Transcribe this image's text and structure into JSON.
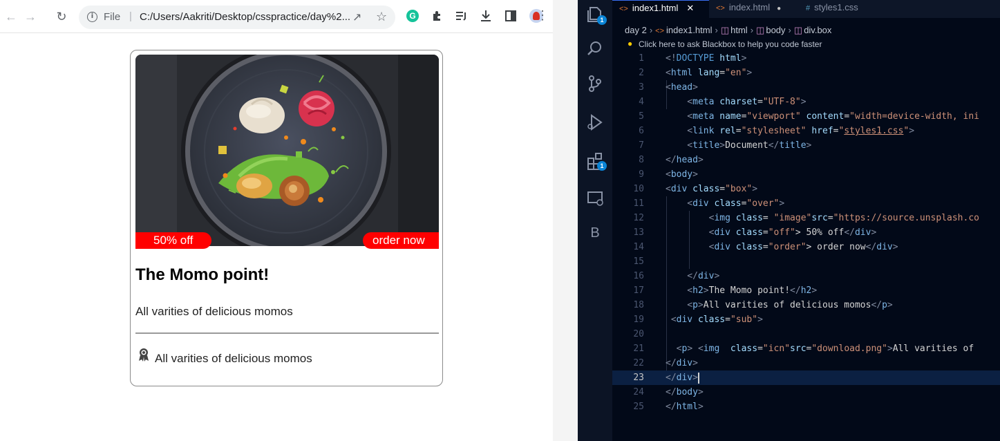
{
  "browser": {
    "url_prefix": "File",
    "url_text": "C:/Users/Aakriti/Desktop/csspractice/day%2...",
    "icons": [
      "back-arrow-icon",
      "forward-arrow-icon",
      "reload-icon",
      "info-icon",
      "share-icon",
      "star-icon",
      "grammarly-icon",
      "extensions-icon",
      "reading-list-icon",
      "download-icon",
      "side-panel-icon",
      "profile-icon",
      "menu-icon"
    ]
  },
  "card": {
    "off_label": "50% off",
    "order_label": "order now",
    "title": "The Momo point!",
    "description": "All varities of delicious momos",
    "sub_text": "All varities of delicious momos"
  },
  "editor": {
    "tabs": [
      {
        "label": "index1.html",
        "state": "active"
      },
      {
        "label": "index.html",
        "state": "inactive"
      },
      {
        "label": "styles1.css",
        "state": "inactive"
      }
    ],
    "breadcrumb": [
      "day 2",
      "index1.html",
      "html",
      "body",
      "div.box"
    ],
    "hint": "Click here to ask Blackbox to help you code faster",
    "activity_badges": [
      "1",
      "1"
    ],
    "activity_letter": "B",
    "current_line": 23,
    "lines": [
      {
        "n": "1",
        "tokens": [
          [
            "<!",
            "punc"
          ],
          [
            "DOCTYPE",
            "doctype"
          ],
          [
            " html",
            "attr"
          ],
          [
            ">",
            "punc"
          ]
        ]
      },
      {
        "n": "2",
        "tokens": [
          [
            "<",
            "punc"
          ],
          [
            "html",
            "tag"
          ],
          [
            " lang",
            "attr"
          ],
          [
            "=",
            "text"
          ],
          [
            "\"en\"",
            "str"
          ],
          [
            ">",
            "punc"
          ]
        ]
      },
      {
        "n": "3",
        "tokens": [
          [
            "<",
            "punc"
          ],
          [
            "head",
            "tag"
          ],
          [
            ">",
            "punc"
          ]
        ]
      },
      {
        "n": "4",
        "tokens": [
          [
            "    <",
            "punc"
          ],
          [
            "meta",
            "tag"
          ],
          [
            " charset",
            "attr"
          ],
          [
            "=",
            "text"
          ],
          [
            "\"UTF-8\"",
            "str"
          ],
          [
            ">",
            "punc"
          ]
        ]
      },
      {
        "n": "5",
        "tokens": [
          [
            "    <",
            "punc"
          ],
          [
            "meta",
            "tag"
          ],
          [
            " name",
            "attr"
          ],
          [
            "=",
            "text"
          ],
          [
            "\"viewport\"",
            "str"
          ],
          [
            " content",
            "attr"
          ],
          [
            "=",
            "text"
          ],
          [
            "\"width=device-width, ini",
            "str"
          ]
        ]
      },
      {
        "n": "6",
        "tokens": [
          [
            "    <",
            "punc"
          ],
          [
            "link",
            "tag"
          ],
          [
            " rel",
            "attr"
          ],
          [
            "=",
            "text"
          ],
          [
            "\"stylesheet\"",
            "str"
          ],
          [
            " href",
            "attr"
          ],
          [
            "=",
            "text"
          ],
          [
            "\"",
            "str"
          ],
          [
            "styles1.css",
            "link"
          ],
          [
            "\"",
            "str"
          ],
          [
            ">",
            "punc"
          ]
        ]
      },
      {
        "n": "7",
        "tokens": [
          [
            "    <",
            "punc"
          ],
          [
            "title",
            "tag"
          ],
          [
            ">",
            "punc"
          ],
          [
            "Document",
            "text"
          ],
          [
            "</",
            "punc"
          ],
          [
            "title",
            "tag"
          ],
          [
            ">",
            "punc"
          ]
        ]
      },
      {
        "n": "8",
        "tokens": [
          [
            "</",
            "punc"
          ],
          [
            "head",
            "tag"
          ],
          [
            ">",
            "punc"
          ]
        ]
      },
      {
        "n": "9",
        "tokens": [
          [
            "<",
            "punc"
          ],
          [
            "body",
            "tag"
          ],
          [
            ">",
            "punc"
          ]
        ]
      },
      {
        "n": "10",
        "tokens": [
          [
            "<",
            "punc"
          ],
          [
            "div",
            "tag"
          ],
          [
            " class",
            "attr"
          ],
          [
            "=",
            "text"
          ],
          [
            "\"box\"",
            "str"
          ],
          [
            ">",
            "punc"
          ]
        ]
      },
      {
        "n": "11",
        "tokens": [
          [
            "    <",
            "punc"
          ],
          [
            "div",
            "tag"
          ],
          [
            " class",
            "attr"
          ],
          [
            "=",
            "text"
          ],
          [
            "\"over\"",
            "str"
          ],
          [
            ">",
            "punc"
          ]
        ]
      },
      {
        "n": "12",
        "tokens": [
          [
            "        <",
            "punc"
          ],
          [
            "img",
            "tag"
          ],
          [
            " class",
            "attr"
          ],
          [
            "= ",
            "text"
          ],
          [
            "\"image\"",
            "str"
          ],
          [
            "src",
            "attr"
          ],
          [
            "=",
            "text"
          ],
          [
            "\"https://source.unsplash.co",
            "str"
          ]
        ]
      },
      {
        "n": "13",
        "tokens": [
          [
            "        <",
            "punc"
          ],
          [
            "div",
            "tag"
          ],
          [
            " class",
            "attr"
          ],
          [
            "=",
            "text"
          ],
          [
            "\"off\"",
            "str"
          ],
          [
            "> 50% off",
            "text"
          ],
          [
            "</",
            "punc"
          ],
          [
            "div",
            "tag"
          ],
          [
            ">",
            "punc"
          ]
        ]
      },
      {
        "n": "14",
        "tokens": [
          [
            "        <",
            "punc"
          ],
          [
            "div",
            "tag"
          ],
          [
            " class",
            "attr"
          ],
          [
            "=",
            "text"
          ],
          [
            "\"order\"",
            "str"
          ],
          [
            "> order now",
            "text"
          ],
          [
            "</",
            "punc"
          ],
          [
            "div",
            "tag"
          ],
          [
            ">",
            "punc"
          ]
        ]
      },
      {
        "n": "15",
        "tokens": []
      },
      {
        "n": "16",
        "tokens": [
          [
            "    </",
            "punc"
          ],
          [
            "div",
            "tag"
          ],
          [
            ">",
            "punc"
          ]
        ]
      },
      {
        "n": "17",
        "tokens": [
          [
            "    <",
            "punc"
          ],
          [
            "h2",
            "tag"
          ],
          [
            ">",
            "punc"
          ],
          [
            "The Momo point!",
            "text"
          ],
          [
            "</",
            "punc"
          ],
          [
            "h2",
            "tag"
          ],
          [
            ">",
            "punc"
          ]
        ]
      },
      {
        "n": "18",
        "tokens": [
          [
            "    <",
            "punc"
          ],
          [
            "p",
            "tag"
          ],
          [
            ">",
            "punc"
          ],
          [
            "All varities of delicious momos",
            "text"
          ],
          [
            "</",
            "punc"
          ],
          [
            "p",
            "tag"
          ],
          [
            ">",
            "punc"
          ]
        ]
      },
      {
        "n": "19",
        "tokens": [
          [
            " <",
            "punc"
          ],
          [
            "div",
            "tag"
          ],
          [
            " class",
            "attr"
          ],
          [
            "=",
            "text"
          ],
          [
            "\"sub\"",
            "str"
          ],
          [
            ">",
            "punc"
          ]
        ]
      },
      {
        "n": "20",
        "tokens": []
      },
      {
        "n": "21",
        "tokens": [
          [
            "  <",
            "punc"
          ],
          [
            "p",
            "tag"
          ],
          [
            "> ",
            "punc"
          ],
          [
            "<",
            "punc"
          ],
          [
            "img",
            "tag"
          ],
          [
            "  class",
            "attr"
          ],
          [
            "=",
            "text"
          ],
          [
            "\"icn\"",
            "str"
          ],
          [
            "src",
            "attr"
          ],
          [
            "=",
            "text"
          ],
          [
            "\"download.png\"",
            "str"
          ],
          [
            ">",
            "punc"
          ],
          [
            "All varities of",
            "text"
          ]
        ]
      },
      {
        "n": "22",
        "tokens": [
          [
            "</",
            "punc"
          ],
          [
            "div",
            "tag"
          ],
          [
            ">",
            "punc"
          ]
        ]
      },
      {
        "n": "23",
        "tokens": [
          [
            "</",
            "punc"
          ],
          [
            "div",
            "tag"
          ],
          [
            ">",
            "punc"
          ]
        ]
      },
      {
        "n": "24",
        "tokens": [
          [
            "</",
            "punc"
          ],
          [
            "body",
            "tag"
          ],
          [
            ">",
            "punc"
          ]
        ]
      },
      {
        "n": "25",
        "tokens": [
          [
            "</",
            "punc"
          ],
          [
            "html",
            "tag"
          ],
          [
            ">",
            "punc"
          ]
        ]
      }
    ]
  }
}
